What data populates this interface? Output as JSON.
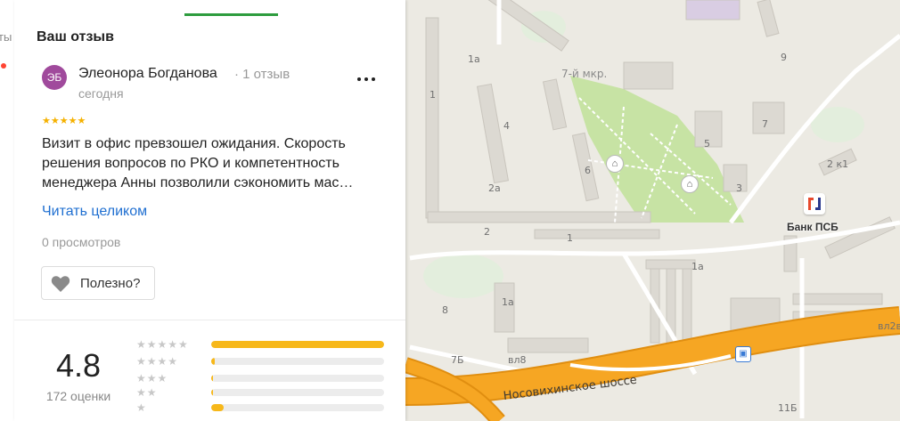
{
  "map": {
    "district_label": "7-й мкр.",
    "road_label": "Носовихинское шоссе",
    "building_numbers": [
      "1а",
      "1",
      "4",
      "2а",
      "6",
      "5",
      "7",
      "9",
      "2 к1",
      "3",
      "2",
      "1",
      "8",
      "1а",
      "1а",
      "7Б",
      "вл8",
      "вл2в",
      "11Б"
    ],
    "bank": {
      "name": "Банк ПСБ",
      "brand_colors": [
        "#e7492d",
        "#2b3a8e"
      ]
    },
    "colors": {
      "background": "#eceae3",
      "park": "#c7e3a4",
      "road_major": "#f6a623",
      "road_outline": "#e08e10",
      "building": "#dcd9d2",
      "water": "#e5f0e5"
    }
  },
  "left_strip": {
    "cut_text": "ты"
  },
  "review_panel": {
    "section_title": "Ваш отзыв",
    "reviewer": {
      "initials": "ЭБ",
      "avatar_color": "#a04a9c",
      "name": "Элеонора Богданова",
      "review_count": "· 1 отзыв",
      "date": "сегодня"
    },
    "more_icon": "more-dots-icon",
    "stars": "★★★★★",
    "star_color": "#f5b100",
    "text_lines": [
      "Визит в офис превзошел ожидания. Скорость",
      "решения вопросов по РКО и компетентность",
      "менеджера Анны позволили сэкономить мас…"
    ],
    "read_more": "Читать целиком",
    "views": "0 просмотров",
    "helpful_button": {
      "label": "Полезно?",
      "icon": "heart-icon"
    }
  },
  "rating_summary": {
    "value": "4.8",
    "count_label": "172 оценки",
    "distribution": [
      {
        "stars": "★★★★★",
        "fraction": 1.0
      },
      {
        "stars": "★★★★",
        "fraction": 0.02
      },
      {
        "stars": "★★★",
        "fraction": 0.01
      },
      {
        "stars": "★★",
        "fraction": 0.01
      },
      {
        "stars": "★",
        "fraction": 0.07
      }
    ],
    "bar_color": "#f7b81a"
  }
}
